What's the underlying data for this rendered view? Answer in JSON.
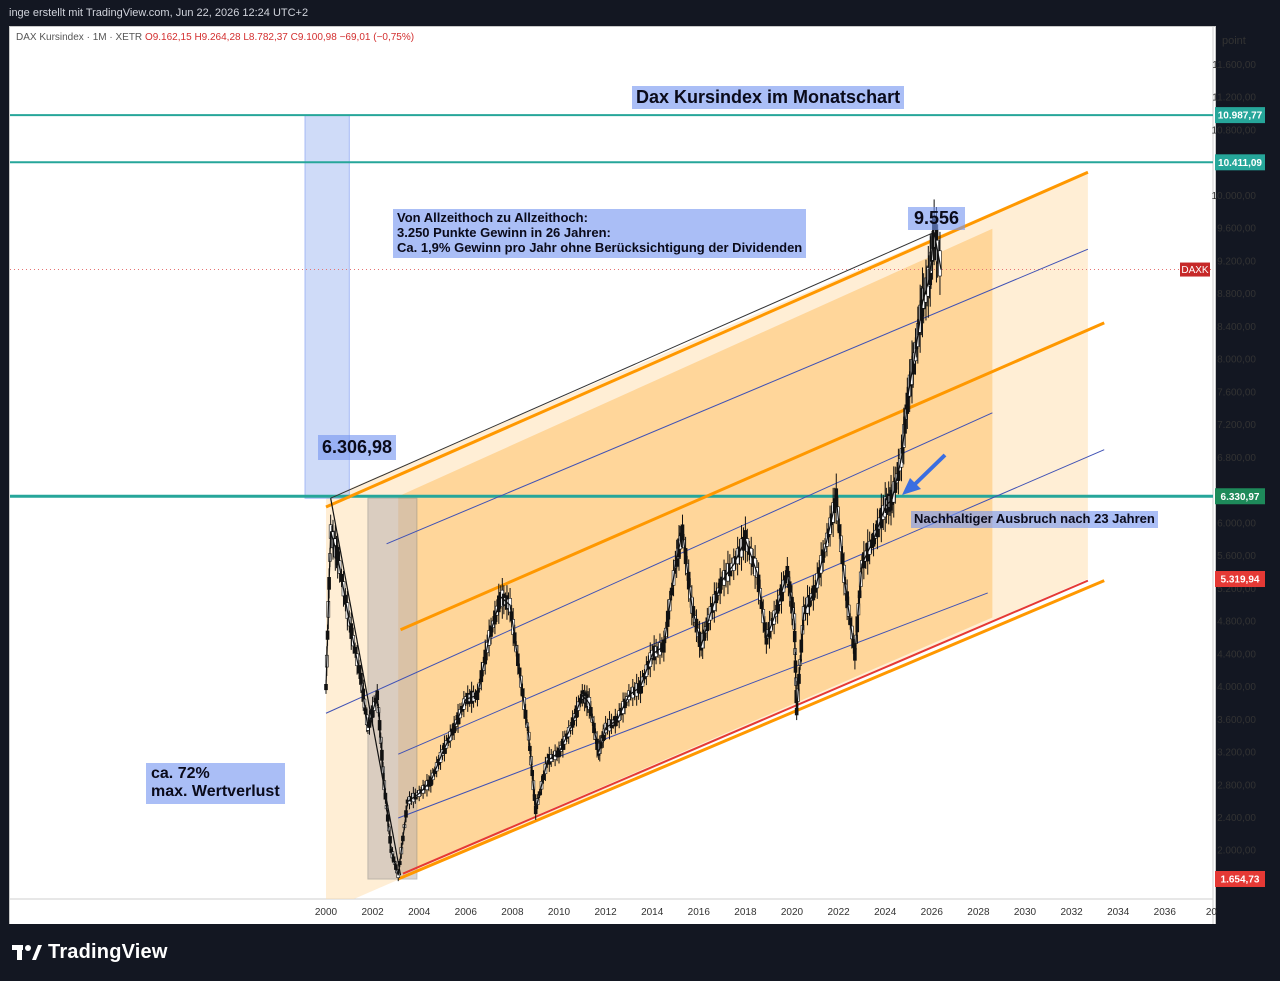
{
  "header": {
    "caption": "inge erstellt mit TradingView.com, Jun 22, 2026 12:24 UTC+2"
  },
  "legend": {
    "symbol": "DAX Kursindex · 1M · XETR",
    "open": "O9.162,15",
    "high": "H9.264,28",
    "low": "L8.782,37",
    "close": "C9.100,98",
    "change": "−69,01 (−0,75%)"
  },
  "price_axis": {
    "unit": "point",
    "ticks": [
      "11.600,00",
      "11.200,00",
      "10.800,00",
      "10.000,00",
      "9.600,00",
      "9.200,00",
      "8.800,00",
      "8.400,00",
      "8.000,00",
      "7.600,00",
      "7.200,00",
      "6.800,00",
      "6.000,00",
      "5.600,00",
      "5.200,00",
      "4.800,00",
      "4.400,00",
      "4.000,00",
      "3.600,00",
      "3.200,00",
      "2.800,00",
      "2.400,00",
      "2.000,00"
    ],
    "badges": [
      {
        "text": "10.987,77",
        "color": "#26a69a"
      },
      {
        "text": "10.411,09",
        "color": "#26a69a"
      },
      {
        "text": "DAXK",
        "color": "#c62828"
      },
      {
        "text": "6.330,97",
        "color": "#1e8a5a"
      },
      {
        "text": "5.319,94",
        "color": "#e53935"
      },
      {
        "text": "1.654,73",
        "color": "#e53935"
      }
    ]
  },
  "time_axis": {
    "ticks": [
      "2000",
      "2002",
      "2004",
      "2006",
      "2008",
      "2010",
      "2012",
      "2014",
      "2016",
      "2018",
      "2020",
      "2022",
      "2024",
      "2026",
      "2028",
      "2030",
      "2032",
      "2034",
      "2036",
      "20"
    ]
  },
  "annotations": {
    "title": "Dax Kursindex im Monatschart",
    "gain_note": "Von Allzeithoch zu Allzeithoch:\n3.250 Punkte Gewinn in 26 Jahren:\nCa. 1,9% Gewinn pro Jahr ohne Berücksichtigung der Dividenden",
    "peak_2000": "6.306,98",
    "peak_2026": "9.556",
    "breakout": "Nachhaltiger Ausbruch nach 23 Jahren",
    "drawdown": "ca. 72%\nmax. Wertverlust"
  },
  "footer": {
    "brand": "TradingView"
  },
  "colors": {
    "channel_line": "#ff9800",
    "channel_fill": "#ffcc80",
    "median_line": "#3f51b5",
    "horizontal_line": "#26a69a",
    "breakout_line": "#2e8b57",
    "candle_body": "#111111",
    "label_bg": "#7696f0"
  },
  "chart_data": {
    "type": "line",
    "x_unit": "year",
    "y_unit": "points",
    "ylim": [
      1654.73,
      11800
    ],
    "xlim": [
      1998.8,
      2036.9
    ],
    "series": [
      {
        "values_x": [
          2000.0,
          2000.2,
          2000.5,
          2001.0,
          2001.5,
          2001.8,
          2002.2,
          2002.5,
          2002.8,
          2003.1,
          2003.5,
          2004.0,
          2004.5,
          2005.0,
          2005.5,
          2006.0,
          2006.5,
          2007.0,
          2007.5,
          2007.9,
          2008.3,
          2008.7,
          2009.0,
          2009.5,
          2010.0,
          2010.5,
          2011.0,
          2011.3,
          2011.7,
          2012.0,
          2012.5,
          2013.0,
          2013.5,
          2014.0,
          2014.5,
          2015.0,
          2015.3,
          2015.7,
          2016.1,
          2016.5,
          2017.0,
          2017.5,
          2018.0,
          2018.5,
          2018.9,
          2019.3,
          2019.8,
          2020.1,
          2020.2,
          2020.5,
          2021.0,
          2021.5,
          2021.9,
          2022.3,
          2022.7,
          2023.0,
          2023.5,
          2024.0,
          2024.3,
          2024.7,
          2025.0,
          2025.3,
          2025.6,
          2025.9,
          2026.1,
          2026.4
        ],
        "values_y": [
          4000,
          5900,
          5600,
          4800,
          4100,
          3500,
          3900,
          2800,
          2000,
          1700,
          2600,
          2700,
          2850,
          3200,
          3500,
          3850,
          3900,
          4600,
          5100,
          5000,
          4200,
          3400,
          2500,
          3100,
          3200,
          3500,
          3900,
          3800,
          3200,
          3500,
          3600,
          3900,
          4000,
          4400,
          4500,
          5500,
          5900,
          5000,
          4500,
          4900,
          5300,
          5500,
          5800,
          5400,
          4600,
          4900,
          5400,
          4800,
          3700,
          4900,
          5200,
          5800,
          6300,
          5200,
          4400,
          5500,
          5800,
          6200,
          6300,
          6800,
          7600,
          8100,
          8700,
          9000,
          9556,
          9100
        ]
      }
    ],
    "horizontal_levels": [
      10987.77,
      10411.09,
      6330.97
    ],
    "markers": [
      {
        "label": "6.306,98",
        "x": 2000.2,
        "y": 6306.98
      },
      {
        "label": "9.556",
        "x": 2026.1,
        "y": 9556
      }
    ]
  }
}
